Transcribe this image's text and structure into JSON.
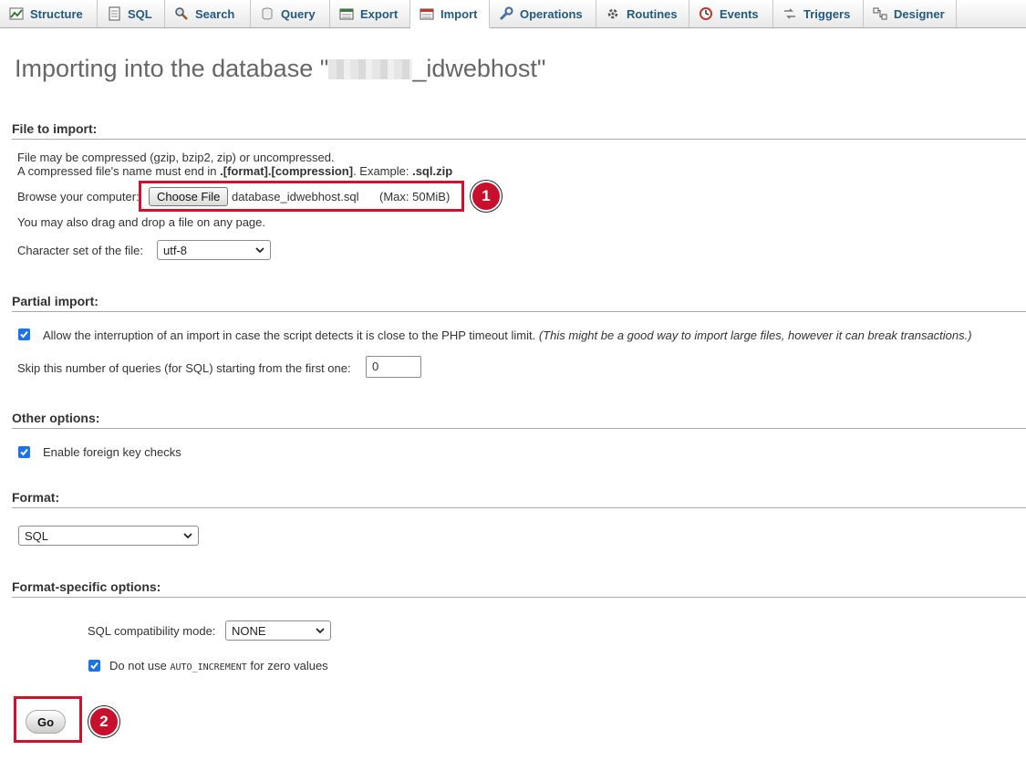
{
  "tabs": [
    {
      "label": "Structure",
      "icon": "structure-icon"
    },
    {
      "label": "SQL",
      "icon": "sql-icon"
    },
    {
      "label": "Search",
      "icon": "search-icon"
    },
    {
      "label": "Query",
      "icon": "query-icon"
    },
    {
      "label": "Export",
      "icon": "export-icon"
    },
    {
      "label": "Import",
      "icon": "import-icon",
      "active": true
    },
    {
      "label": "Operations",
      "icon": "wrench-icon"
    },
    {
      "label": "Routines",
      "icon": "routines-icon"
    },
    {
      "label": "Events",
      "icon": "clock-icon"
    },
    {
      "label": "Triggers",
      "icon": "triggers-icon"
    },
    {
      "label": "Designer",
      "icon": "designer-icon"
    }
  ],
  "title": {
    "prefix": "Importing into the database \"",
    "suffix": "_idwebhost\""
  },
  "file_import": {
    "heading": "File to import:",
    "line1": "File may be compressed (gzip, bzip2, zip) or uncompressed.",
    "line2_prefix": "A compressed file's name must end in ",
    "line2_bold": ".[format].[compression]",
    "line2_mid": ". Example: ",
    "line2_example": ".sql.zip",
    "browse_label": "Browse your computer:",
    "choose_button": "Choose File",
    "file_name": "database_idwebhost.sql",
    "max_size": "(Max: 50MiB)",
    "drag_note": "You may also drag and drop a file on any page.",
    "charset_label": "Character set of the file:",
    "charset_value": "utf-8"
  },
  "partial_import": {
    "heading": "Partial import:",
    "allow_interrupt_label": "Allow the interruption of an import in case the script detects it is close to the PHP timeout limit.",
    "allow_interrupt_note": "(This might be a good way to import large files, however it can break transactions.)",
    "allow_interrupt_checked": true,
    "skip_label": "Skip this number of queries (for SQL) starting from the first one:",
    "skip_value": "0"
  },
  "other_options": {
    "heading": "Other options:",
    "fk_label": "Enable foreign key checks",
    "fk_checked": true
  },
  "format": {
    "heading": "Format:",
    "value": "SQL"
  },
  "format_specific": {
    "heading": "Format-specific options:",
    "compat_label": "SQL compatibility mode:",
    "compat_value": "NONE",
    "auto_inc_prefix": "Do not use ",
    "auto_inc_code": "AUTO_INCREMENT",
    "auto_inc_suffix": " for zero values",
    "auto_inc_checked": true
  },
  "go_button": "Go",
  "markers": [
    "1",
    "2"
  ],
  "colors": {
    "tab_text": "#235a81",
    "highlight": "#d40f2d",
    "marker": "#c8102e",
    "checkbox": "#1a73e8"
  }
}
